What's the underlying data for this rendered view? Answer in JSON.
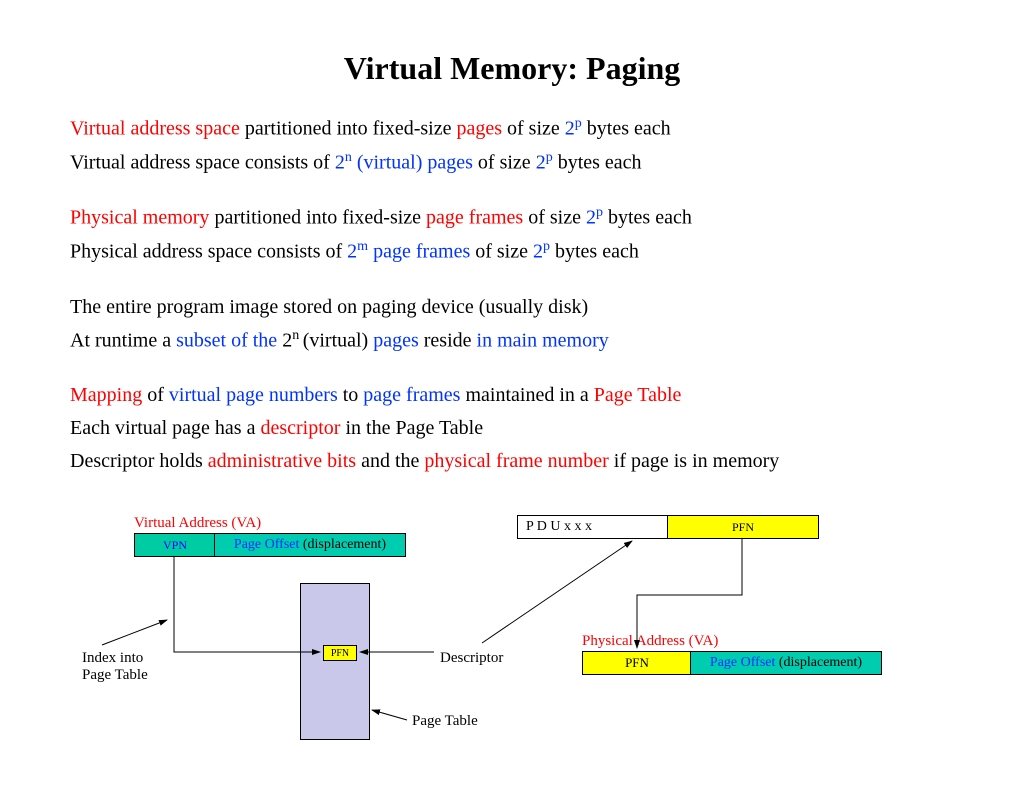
{
  "title": "Virtual Memory: Paging",
  "lines": {
    "l1_a": "Virtual address space",
    "l1_b": " partitioned into fixed-size ",
    "l1_c": "pages",
    "l1_d": " of size ",
    "l1_e": "2",
    "l1_f": "p",
    "l1_g": " bytes each",
    "l2_a": "Virtual address space consists of ",
    "l2_b": "2",
    "l2_c": "n",
    "l2_d": "  (virtual) pages ",
    "l2_e": " of size ",
    "l2_f": "2",
    "l2_g": "p",
    "l2_h": " bytes each",
    "l3_a": "Physical memory ",
    "l3_b": " partitioned into fixed-size ",
    "l3_c": "page frames",
    "l3_d": " of size ",
    "l3_e": "2",
    "l3_f": "p",
    "l3_g": " bytes each",
    "l4_a": "Physical address space consists of ",
    "l4_b": "2",
    "l4_c": "m",
    "l4_d": "  page frames ",
    "l4_e": " of size ",
    "l4_f": "2",
    "l4_g": "p",
    "l4_h": " bytes each",
    "l5": "The entire program image stored on paging device (usually disk)",
    "l6_a": "At runtime a ",
    "l6_b": "subset of the ",
    "l6_c": "2",
    "l6_d": "n ",
    "l6_e": "(virtual) ",
    "l6_f": "pages",
    "l6_g": " reside ",
    "l6_h": "in main memory",
    "l7_a": "Mapping",
    "l7_b": " of ",
    "l7_c": "virtual page numbers",
    "l7_d": " to ",
    "l7_e": "page frames",
    "l7_f": " maintained in a ",
    "l7_g": "Page Table",
    "l8_a": "Each virtual page has a ",
    "l8_b": "descriptor",
    "l8_c": " in the Page Table",
    "l9_a": "Descriptor holds ",
    "l9_b": "administrative bits",
    "l9_c": " and the ",
    "l9_d": "physical frame number",
    "l9_e": " if page  is in memory"
  },
  "diagram": {
    "va_label": "Virtual Address (VA)",
    "vpn": "VPN",
    "page_offset_blue": "Page Offset",
    "page_offset_black": " (displacement)",
    "index_label1": "Index into",
    "index_label2": "Page Table",
    "page_table_label": "Page Table",
    "pfn_small": "PFN",
    "descriptor_label": "Descriptor",
    "pdu": "P D U  x x x",
    "pfn_top": "PFN",
    "pa_label": "Physical Address (VA)",
    "pfn_bottom": "PFN",
    "page_offset2_blue": "Page Offset",
    "page_offset2_black": " (displacement)"
  }
}
